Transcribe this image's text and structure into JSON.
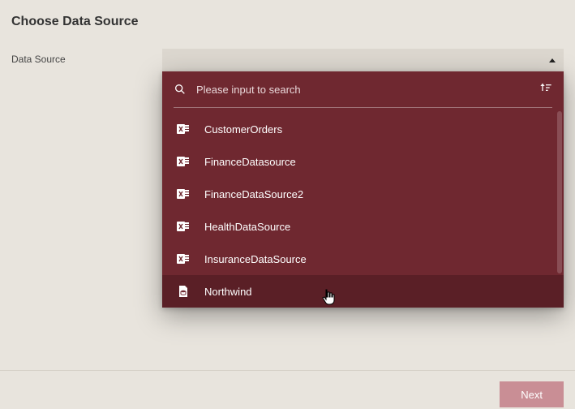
{
  "title": "Choose Data Source",
  "label": "Data Source",
  "search": {
    "placeholder": "Please input to search"
  },
  "items": [
    {
      "label": "CustomerOrders",
      "icon": "excel",
      "hovered": false
    },
    {
      "label": "FinanceDatasource",
      "icon": "excel",
      "hovered": false
    },
    {
      "label": "FinanceDataSource2",
      "icon": "excel",
      "hovered": false
    },
    {
      "label": "HealthDataSource",
      "icon": "excel",
      "hovered": false
    },
    {
      "label": "InsuranceDataSource",
      "icon": "excel",
      "hovered": false
    },
    {
      "label": "Northwind",
      "icon": "db",
      "hovered": true
    }
  ],
  "footer": {
    "next": "Next"
  }
}
